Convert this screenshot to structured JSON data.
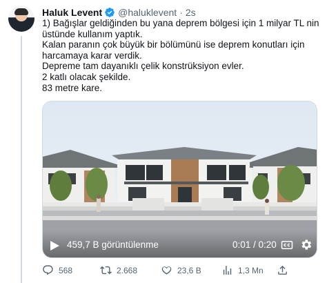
{
  "tweet": {
    "author_name": "Haluk Levent",
    "handle": "@haluklevent",
    "separator": "·",
    "time": "2s",
    "lines": [
      "1) Bağışlar geldiğinden bu yana deprem bölgesi için 1 milyar TL nin",
      "üstünde kullanım yaptık.",
      "Kalan paranın çok büyük bir bölümünü ise deprem konutları için",
      "harcamaya karar verdik.",
      "Depreme tam dayanıklı çelik konstrüksiyon evler.",
      "2 katlı olacak şekilde.",
      "83 metre kare."
    ]
  },
  "video": {
    "views": "459,7 B görüntülenme",
    "duration": "0:01 / 0:20",
    "icons": [
      "play-icon",
      "captions-icon",
      "settings-gear-icon"
    ]
  },
  "actions": {
    "reply_count": "568",
    "retweet_count": "2.668",
    "like_count": "23,6 B",
    "view_count": "1,3 Mn",
    "icons": [
      "reply-icon",
      "retweet-icon",
      "like-icon",
      "analytics-icon",
      "share-icon"
    ]
  },
  "colors": {
    "verified_blue": "#1d9bf0",
    "muted_text": "#536471",
    "primary_text": "#0f1419"
  }
}
